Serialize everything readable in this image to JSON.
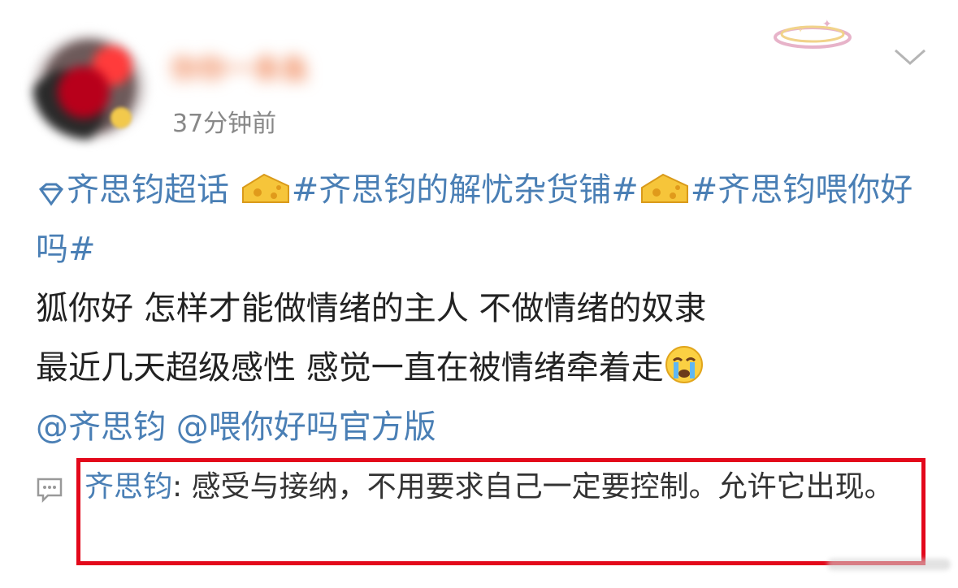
{
  "post": {
    "username": "你你一条鱼",
    "timestamp": "37分钟前",
    "supertopic": "齐思钧超话",
    "topic1": "#齐思钧的解忧杂货铺#",
    "topic2": "#齐思钧喂你好吗#",
    "line1": "狐你好 怎样才能做情绪的主人 不做情绪的奴隶",
    "line2": "最近几天超级感性 感觉一直在被情绪牵着走",
    "mention1": "@齐思钧",
    "mention2": "@喂你好吗官方版"
  },
  "comment": {
    "author": "齐思钧",
    "text": ": 感受与接纳，不用要求自己一定要控制。允许它出现。"
  },
  "colors": {
    "link": "#4a7fb5",
    "highlight_border": "#e3081b",
    "timestamp": "#888888"
  },
  "icons": [
    "supertopic-diamond-icon",
    "cheese-emoji-icon",
    "crying-emoji-icon",
    "comment-icon",
    "chevron-down-icon"
  ]
}
